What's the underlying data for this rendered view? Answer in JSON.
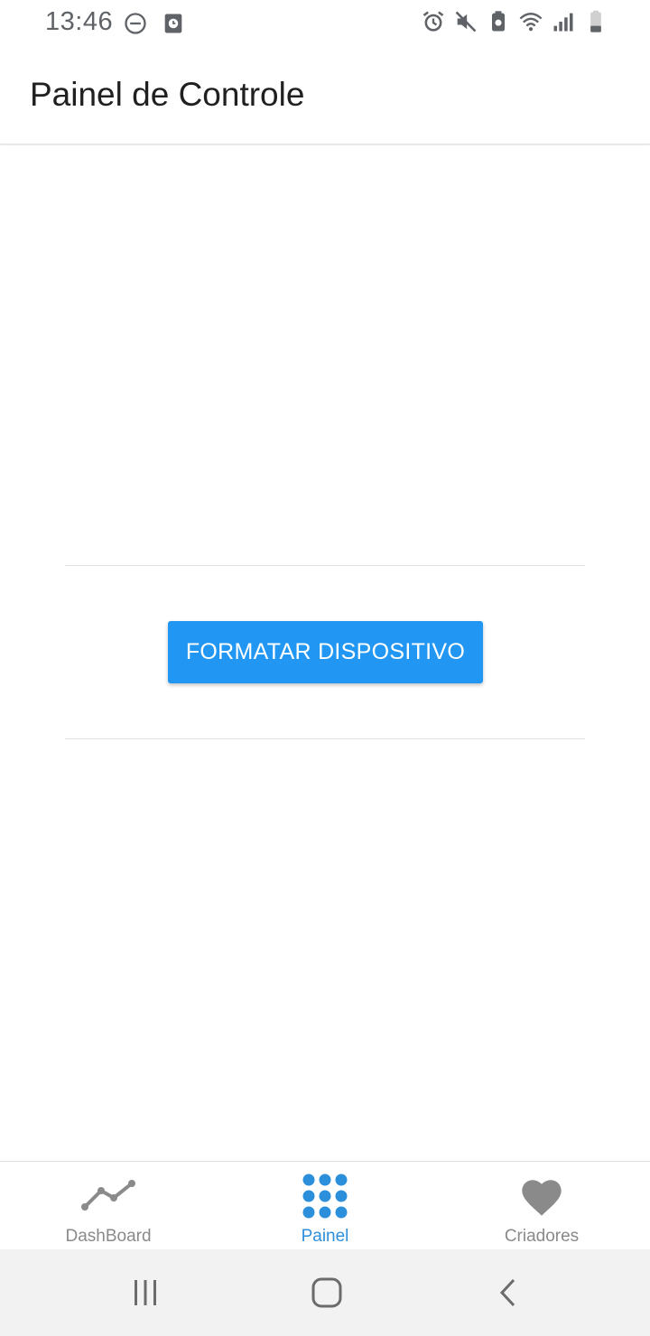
{
  "status_bar": {
    "time": "13:46",
    "left_icons": [
      "do-not-disturb-icon",
      "screenshot-icon"
    ],
    "right_icons": [
      "alarm-icon",
      "mute-icon",
      "battery-saver-icon",
      "wifi-icon",
      "signal-icon",
      "battery-icon"
    ]
  },
  "app_bar": {
    "title": "Painel de Controle"
  },
  "main": {
    "format_button_label": "FORMATAR DISPOSITIVO"
  },
  "bottom_nav": {
    "items": [
      {
        "label": "DashBoard",
        "icon": "line-chart-icon",
        "active": false
      },
      {
        "label": "Painel",
        "icon": "dots-grid-icon",
        "active": true
      },
      {
        "label": "Criadores",
        "icon": "heart-icon",
        "active": false
      }
    ]
  },
  "system_nav": {
    "buttons": [
      "recent-apps-icon",
      "home-icon",
      "back-icon"
    ]
  },
  "colors": {
    "accent": "#2196f3",
    "active_nav": "#2b8fdc",
    "inactive_nav": "#8a8a8a"
  }
}
